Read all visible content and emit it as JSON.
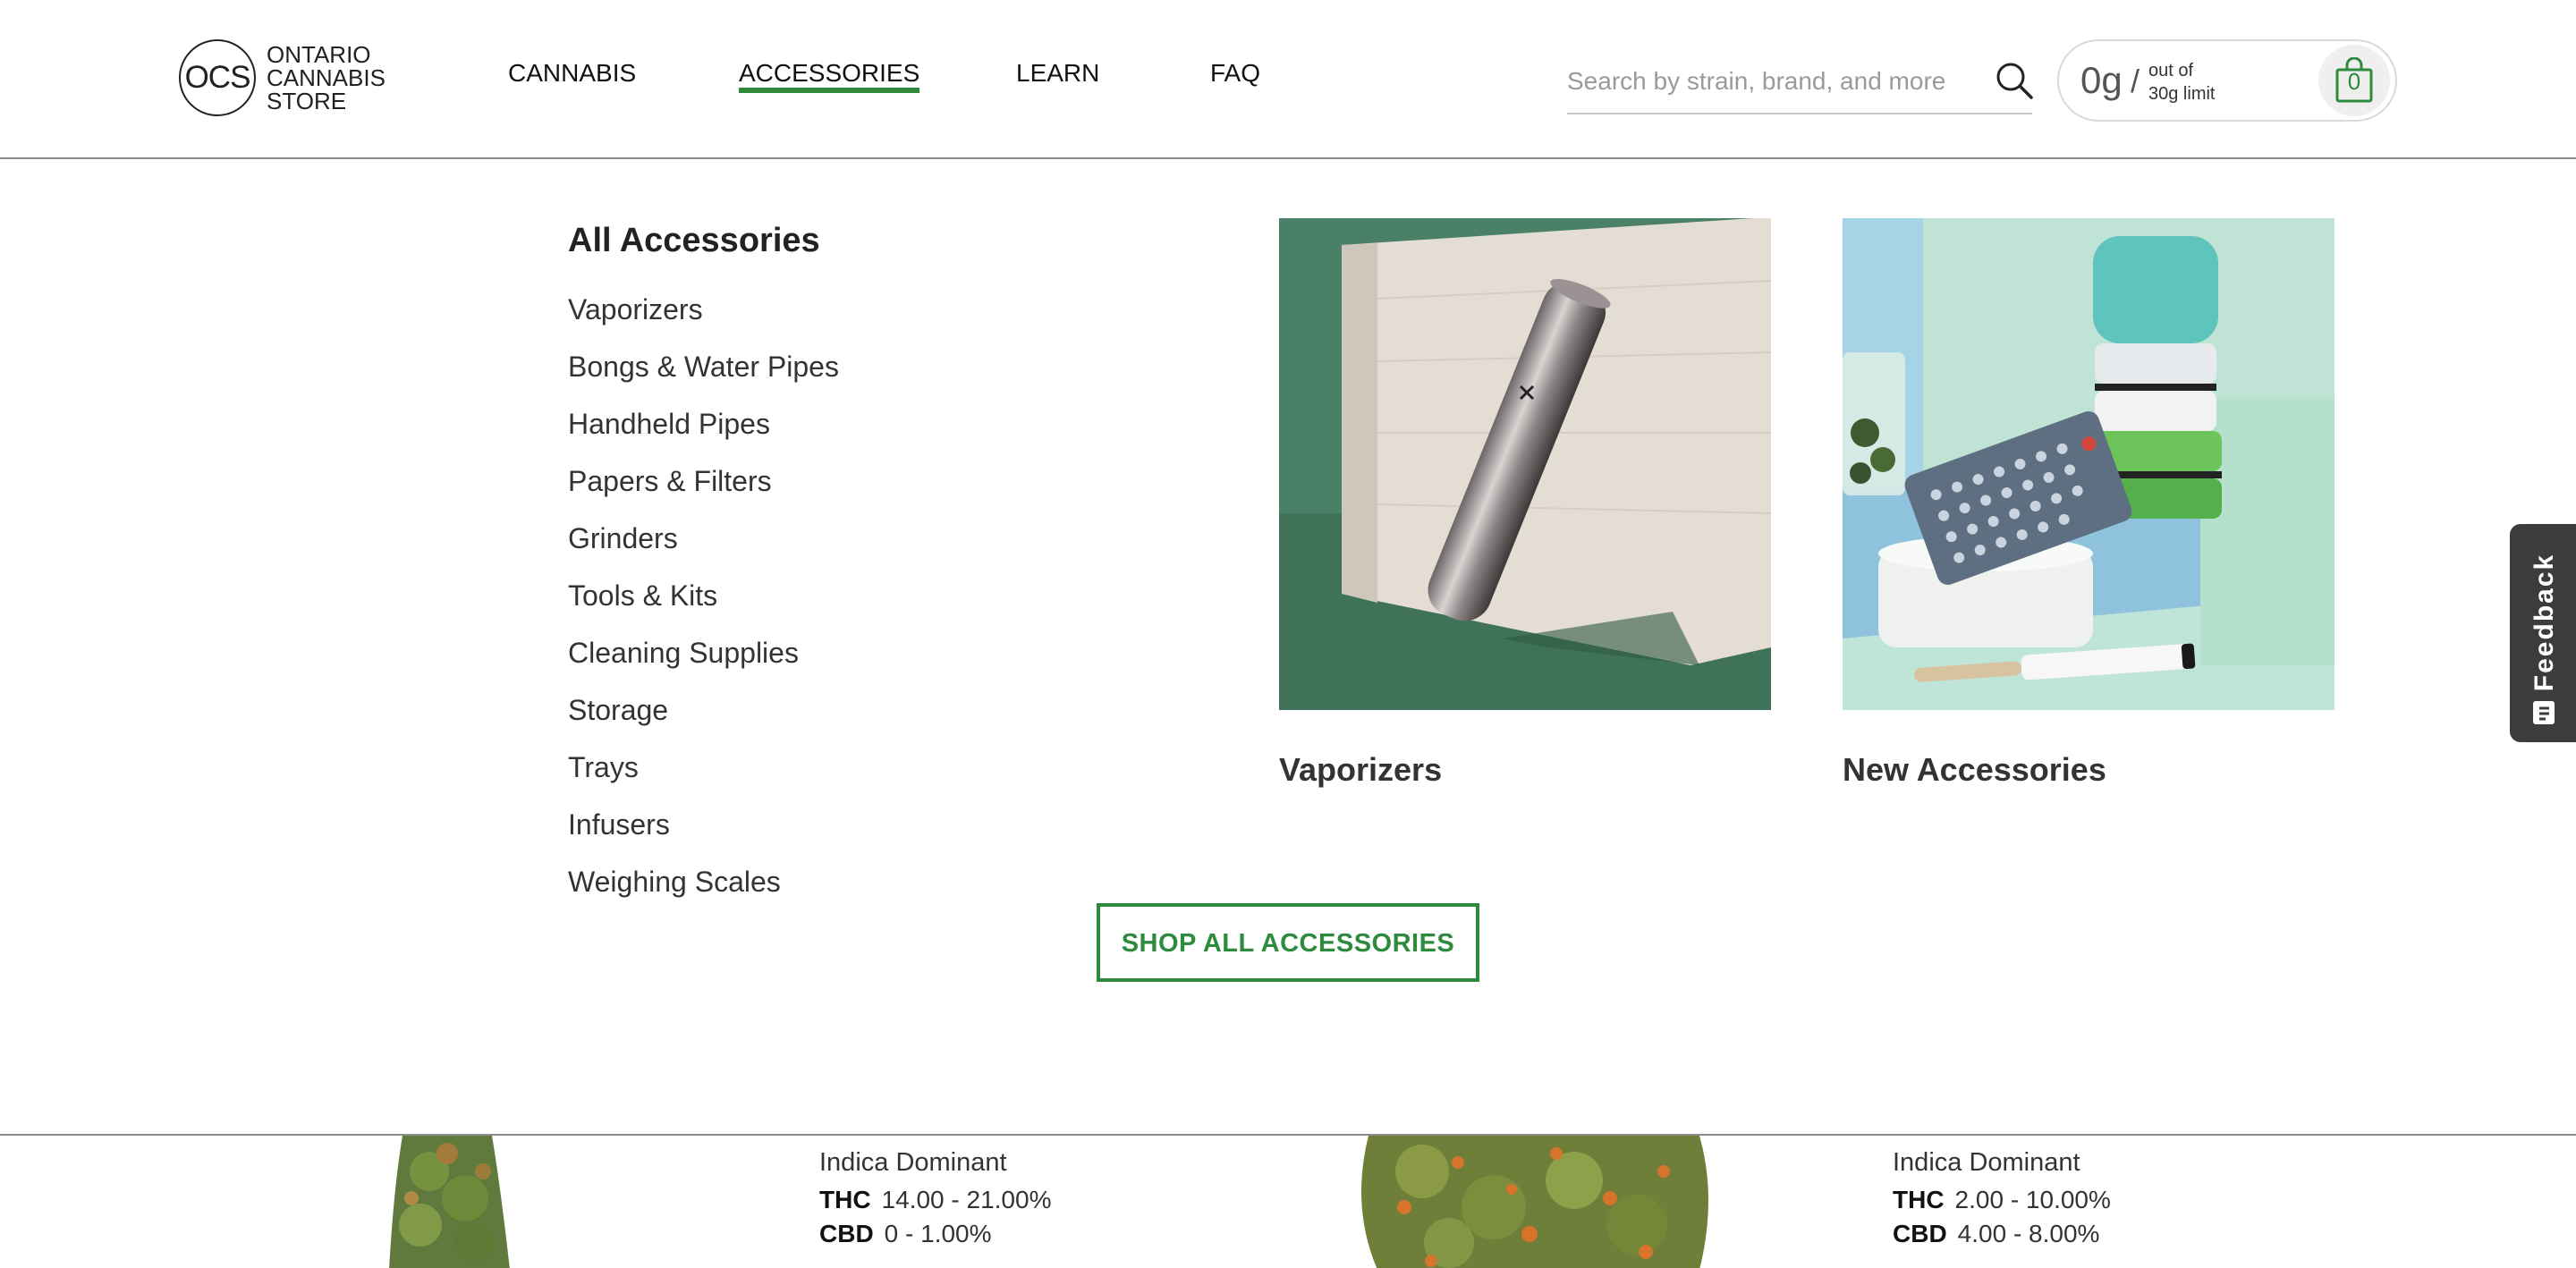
{
  "brand": {
    "logo_mark": "OCS",
    "logo_lines": [
      "ONTARIO",
      "CANNABIS",
      "STORE"
    ]
  },
  "nav": {
    "items": [
      {
        "label": "CANNABIS"
      },
      {
        "label": "ACCESSORIES",
        "active": true
      },
      {
        "label": "LEARN"
      },
      {
        "label": "FAQ"
      }
    ]
  },
  "search": {
    "placeholder": "Search by strain, brand, and more",
    "icon": "search-icon"
  },
  "limit": {
    "amount": "0g",
    "slash": "/",
    "line1": "out of",
    "line2": "30g limit"
  },
  "cart": {
    "count": "0",
    "icon": "shopping-bag-icon"
  },
  "menu": {
    "heading": "All Accessories",
    "items": [
      "Vaporizers",
      "Bongs & Water Pipes",
      "Handheld Pipes",
      "Papers & Filters",
      "Grinders",
      "Tools & Kits",
      "Cleaning Supplies",
      "Storage",
      "Trays",
      "Infusers",
      "Weighing Scales"
    ],
    "features": [
      {
        "label": "Vaporizers"
      },
      {
        "label": "New Accessories"
      }
    ],
    "cta": "SHOP ALL ACCESSORIES"
  },
  "feedback": {
    "label": "Feedback"
  },
  "products": [
    {
      "type": "Indica Dominant",
      "thc_label": "THC",
      "thc": "14.00 - 21.00%",
      "cbd_label": "CBD",
      "cbd": "0 - 1.00%"
    },
    {
      "type": "Indica Dominant",
      "thc_label": "THC",
      "thc": "2.00 - 10.00%",
      "cbd_label": "CBD",
      "cbd": "4.00 - 8.00%"
    }
  ],
  "colors": {
    "accent": "#2e8b3e",
    "text": "#222222",
    "divider": "#8c8c8c",
    "feedback_bg": "#3c3c3c"
  }
}
